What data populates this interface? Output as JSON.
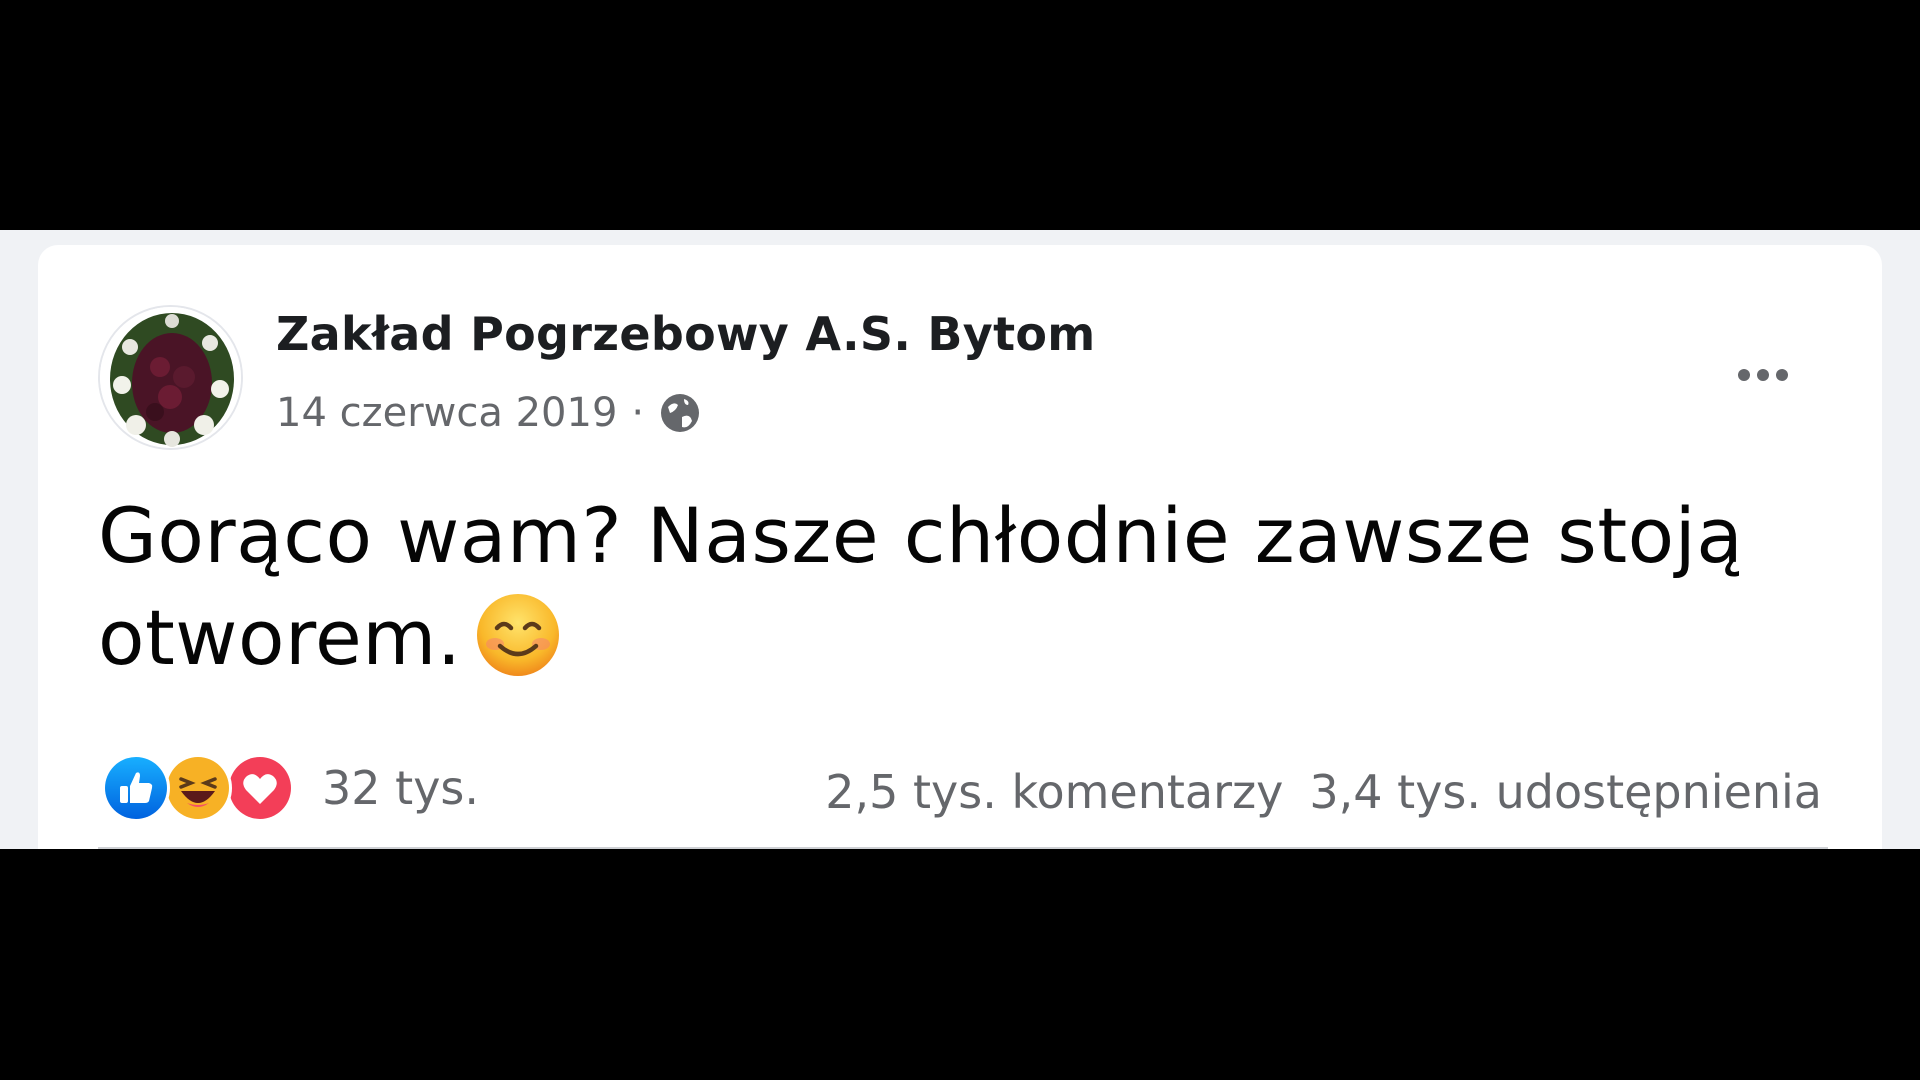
{
  "post": {
    "author": "Zakład Pogrzebowy A.S. Bytom",
    "date": "14 czerwca 2019",
    "separator": "·",
    "privacy_icon": "globe-icon",
    "more_icon": "more-options-icon",
    "text": "Gorąco wam? Nasze chłodnie zawsze stoją otworem.",
    "emoji": "smiling-face-icon"
  },
  "reactions": {
    "icons": [
      "like-icon",
      "haha-icon",
      "love-icon"
    ],
    "count": "32 tys.",
    "comments": "2,5 tys. komentarzy",
    "shares": "3,4 tys. udostępnienia"
  },
  "colors": {
    "like": "#1877f2",
    "love": "#f33e58",
    "haha": "#f7b125",
    "secondary_text": "#65676b",
    "primary_text": "#050505",
    "band_background": "#f0f2f5"
  }
}
